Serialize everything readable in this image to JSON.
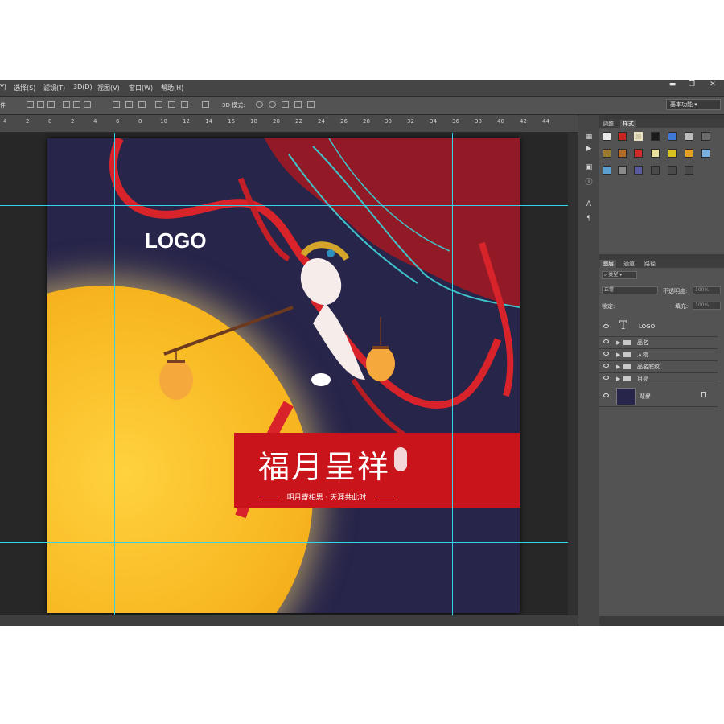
{
  "window": {
    "minimize": "▬",
    "restore": "❐",
    "close": "✕"
  },
  "menu": [
    "Y)",
    "选择(S)",
    "滤镜(T)",
    "3D(D)",
    "视图(V)",
    "窗口(W)",
    "帮助(H)"
  ],
  "options": {
    "left_label": "件",
    "mode_label": "3D 模式:",
    "workspace": "基本功能"
  },
  "ruler": {
    "labels": [
      "4",
      "2",
      "0",
      "2",
      "4",
      "6",
      "8",
      "10",
      "12",
      "14",
      "16",
      "18",
      "20",
      "22",
      "24",
      "26",
      "28",
      "30",
      "32",
      "34",
      "36",
      "38",
      "40",
      "42",
      "44"
    ]
  },
  "document": {
    "logo_text": "LOGO",
    "banner_title": "福月呈祥",
    "banner_subtitle": "明月寄相思 · 天涯共此时",
    "colors": {
      "background": "#27254a",
      "banner": "#c9141b",
      "moon": "#f7b51f"
    }
  },
  "styles_panel": {
    "tabs": [
      "调整",
      "样式"
    ],
    "swatches": [
      "#e8e8e8",
      "#c9241f",
      "#cfc6a6",
      "#1a1a1a",
      "#3e79d6",
      "#bdbdbd",
      "#6b6b6b",
      "#9a7a2e",
      "#b36b2a",
      "#d02a2a",
      "#e8e0a0",
      "#d8c020",
      "#e6a020",
      "#7ab0e0",
      "#5aa0d0",
      "#8a8a8a",
      "#5a5aa0",
      "#4a4a4a",
      "#4a4a4a",
      "#4a4a4a"
    ]
  },
  "layers_panel": {
    "tabs": [
      "图层",
      "通道",
      "路径"
    ],
    "kind_filter": "类型",
    "blend_mode": "正常",
    "opacity_label": "不透明度:",
    "opacity_value": "100%",
    "lock_label": "锁定:",
    "fill_label": "填充:",
    "fill_value": "100%",
    "layers": [
      {
        "name": "LOGO",
        "type": "text"
      },
      {
        "name": "品名",
        "type": "group"
      },
      {
        "name": "人物",
        "type": "group"
      },
      {
        "name": "品名底纹",
        "type": "group"
      },
      {
        "name": "月亮",
        "type": "group"
      },
      {
        "name": "背景",
        "type": "background"
      }
    ]
  },
  "icons": [
    "minimize-icon",
    "restore-icon",
    "close-icon",
    "eye-icon",
    "folder-icon",
    "lock-icon",
    "text-layer-icon",
    "play-icon",
    "info-icon",
    "paragraph-icon"
  ]
}
